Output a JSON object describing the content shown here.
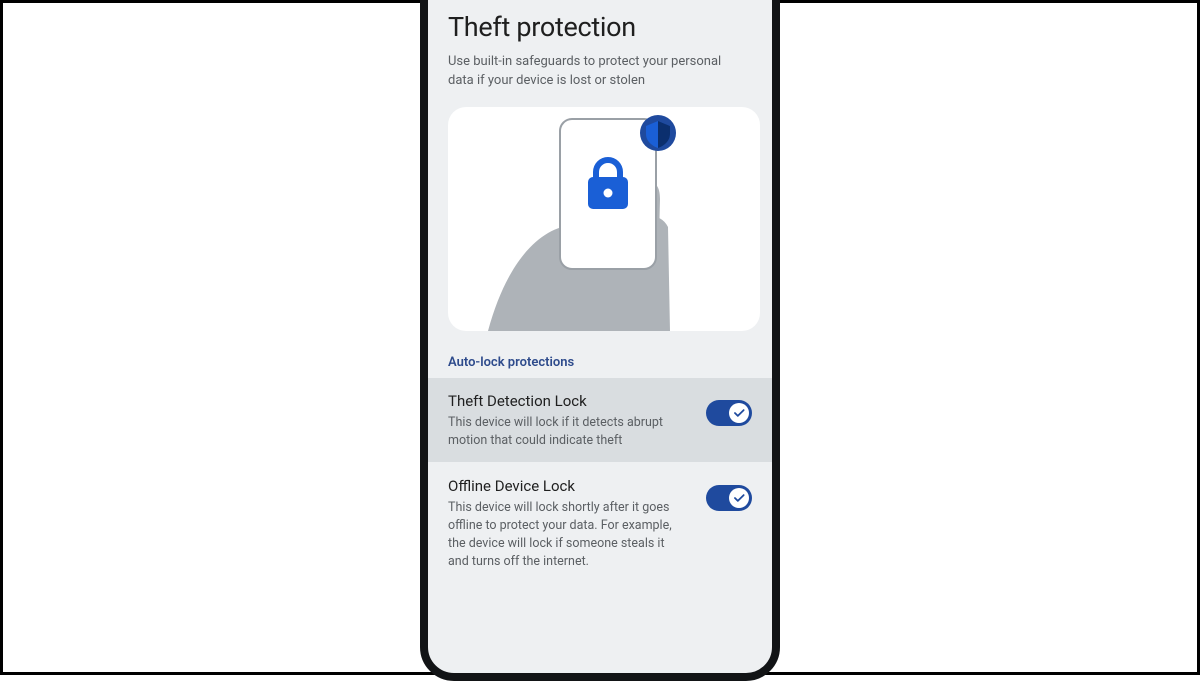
{
  "header": {
    "title": "Theft protection",
    "subtitle": "Use built-in safeguards to protect your personal data if your device is lost or stolen"
  },
  "section_label": "Auto-lock protections",
  "settings": [
    {
      "title": "Theft Detection Lock",
      "desc": "This device will lock if it detects abrupt motion that could indicate theft",
      "on": true
    },
    {
      "title": "Offline Device Lock",
      "desc": "This device will lock shortly after it goes offline to protect your data. For example, the device will lock if someone steals it and turns off the internet.",
      "on": true
    }
  ],
  "colors": {
    "accent": "#1f4a9e",
    "icon_blue": "#1a5fd6"
  }
}
